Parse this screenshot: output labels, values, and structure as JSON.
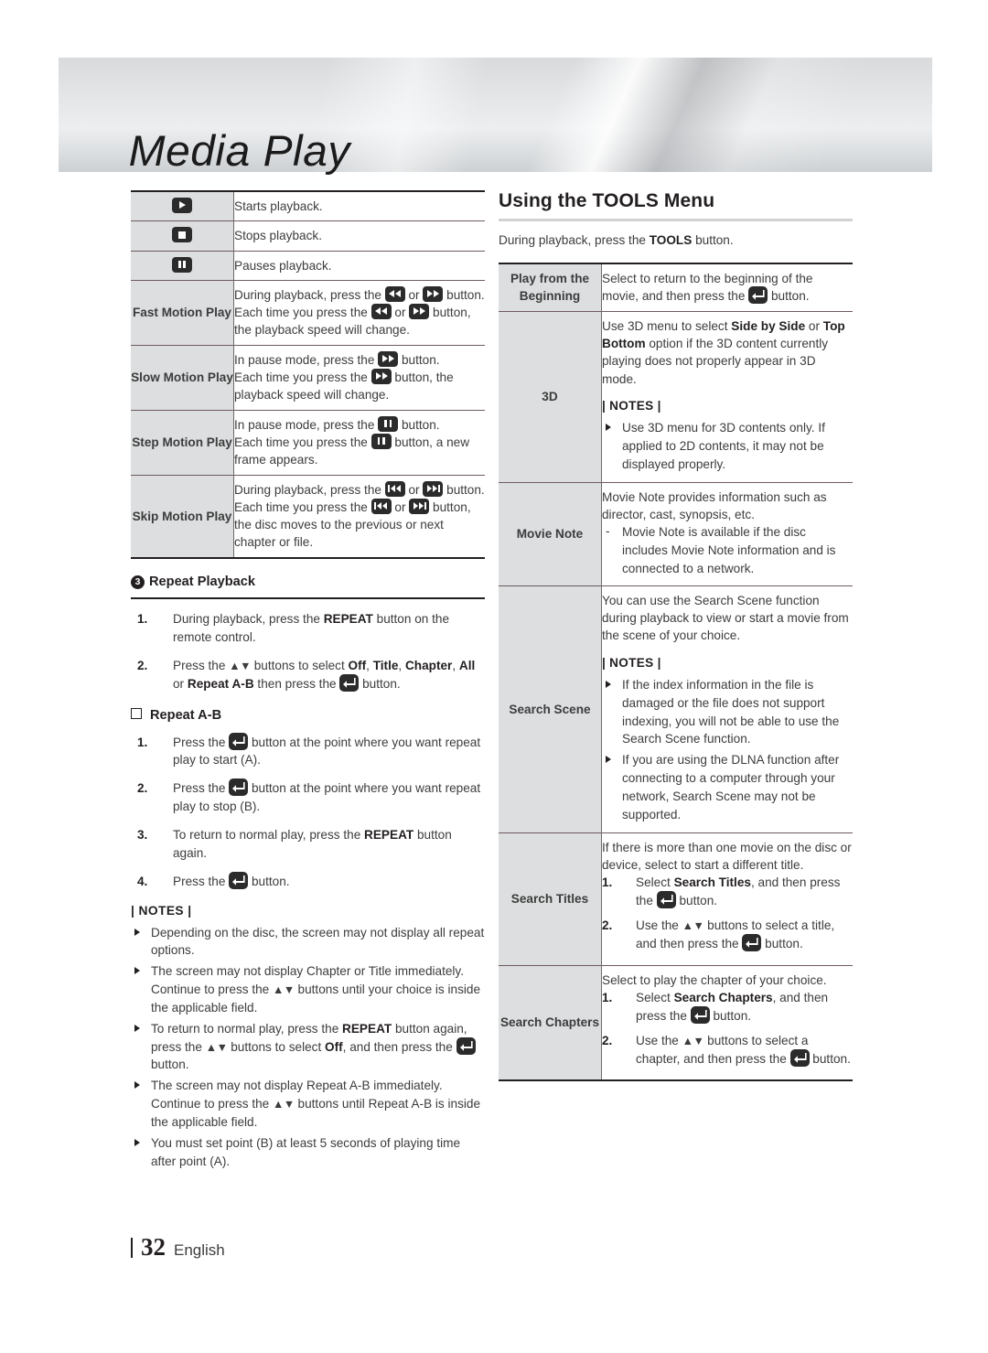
{
  "page": {
    "chapter_title": "Media Play",
    "footer": {
      "page_number": "32",
      "language": "English"
    }
  },
  "playback_table": {
    "rows": [
      {
        "key_icon": "play-icon",
        "key_text": "",
        "desc": "Starts playback."
      },
      {
        "key_icon": "stop-icon",
        "key_text": "",
        "desc": "Stops playback."
      },
      {
        "key_icon": "pause-icon",
        "key_text": "",
        "desc": "Pauses playback."
      },
      {
        "key_icon": "",
        "key_text": "Fast Motion Play",
        "line1a": "During playback, press the ",
        "line1b": " or ",
        "line1c": " button.",
        "line2a": "Each time you press the ",
        "line2b": " or ",
        "line2c": " button, the playback speed will change."
      },
      {
        "key_icon": "",
        "key_text": "Slow Motion Play",
        "line1a": "In pause mode, press the ",
        "line1c": " button.",
        "line2a": "Each time you press the ",
        "line2c": " button, the playback speed will change."
      },
      {
        "key_icon": "",
        "key_text": "Step Motion Play",
        "line1a": "In pause mode, press the ",
        "line1c": " button.",
        "line2a": "Each time you press the ",
        "line2c": " button, a new frame appears."
      },
      {
        "key_icon": "",
        "key_text": "Skip Motion Play",
        "line1a": "During playback, press the ",
        "line1b": " or ",
        "line1c": " button.",
        "line2a": "Each time you press the ",
        "line2b": " or ",
        "line2c": " button, the disc moves to the previous or next chapter or file."
      }
    ]
  },
  "repeat_playback": {
    "marker": "3",
    "heading": "Repeat Playback",
    "steps": [
      {
        "num": "1.",
        "text": "During playback, press the REPEAT button on the remote control."
      },
      {
        "num": "2.",
        "text_parts": [
          "Press the ",
          " buttons to select ",
          "Off",
          ", ",
          "Title",
          ", ",
          "Chapter",
          ", ",
          "All",
          " or ",
          "Repeat A-B",
          " then press the ",
          " button."
        ]
      }
    ],
    "step1_pre": "During playback, press the ",
    "step1_bold": "REPEAT",
    "step1_post": " button on the remote control."
  },
  "repeat_ab": {
    "heading": "Repeat A-B",
    "steps": [
      {
        "num": "1.",
        "pre": "Press the ",
        "post": " button at the point where you want repeat play to start (A)."
      },
      {
        "num": "2.",
        "pre": "Press the ",
        "post": " button at the point where you want repeat play to stop (B)."
      },
      {
        "num": "3.",
        "pre": "To return to normal play, press the ",
        "bold": "REPEAT",
        "post": " button again."
      },
      {
        "num": "4.",
        "pre": "Press the ",
        "post": " button."
      }
    ]
  },
  "left_notes": {
    "label": "| NOTES |",
    "items": [
      {
        "text": "Depending on the disc, the screen may not display all repeat options."
      },
      {
        "a": "The screen may not display Chapter or Title immediately. Continue to press the ",
        "b": " buttons until your choice is inside the applicable field."
      },
      {
        "a": "To return to normal play, press the ",
        "bold1": "REPEAT",
        "b": " button again, press the ",
        "c": " buttons to select ",
        "bold2": "Off",
        "d": ", and then press the ",
        "e": " button."
      },
      {
        "a": "The screen may not display Repeat A-B immediately. Continue to press the ",
        "b": " buttons until Repeat A-B is inside the applicable field."
      },
      {
        "text": "You must set point (B) at least 5 seconds of playing time after point (A)."
      }
    ]
  },
  "tools": {
    "heading": "Using the TOOLS Menu",
    "lead_pre": "During playback, press the ",
    "lead_bold": "TOOLS",
    "lead_post": " button.",
    "rows": {
      "play_from_beginning": {
        "key": "Play from the Beginning",
        "pre": "Select to return to the beginning of the movie, and then press the ",
        "post": " button."
      },
      "three_d": {
        "key": "3D",
        "p1_a": "Use 3D menu to select ",
        "p1_b1": "Side by Side",
        "p1_c": " or ",
        "p1_b2": "Top Bottom",
        "p1_d": " option if the 3D content currently playing does not properly appear in 3D mode.",
        "notes_label": "| NOTES |",
        "note1": "Use 3D menu for 3D contents only. If applied to 2D contents, it may not be displayed properly."
      },
      "movie_note": {
        "key": "Movie Note",
        "p1": "Movie Note provides information such as director, cast, synopsis, etc.",
        "dash1": "Movie Note is available if the disc includes Movie Note information and is connected to a network."
      },
      "search_scene": {
        "key": "Search Scene",
        "p1": "You can use the Search Scene function during playback to view or start a movie from the scene of your choice.",
        "notes_label": "| NOTES |",
        "note1": "If the index information in the file is damaged or the file does not support indexing, you will not be able to use the Search Scene function.",
        "note2": "If you are using the DLNA function after connecting to a computer through your network, Search Scene may not be supported."
      },
      "search_titles": {
        "key": "Search Titles",
        "p1": "If there is more than one movie on the disc or device, select to start a different title.",
        "step1_num": "1.",
        "step1_a": "Select ",
        "step1_bold": "Search Titles",
        "step1_b": ", and then press the ",
        "step1_c": " button.",
        "step2_num": "2.",
        "step2_a": "Use the ",
        "step2_b": " buttons to select a title, and then press the ",
        "step2_c": " button."
      },
      "search_chapters": {
        "key": "Search Chapters",
        "p1": "Select to play the chapter of your choice.",
        "step1_num": "1.",
        "step1_a": "Select ",
        "step1_bold": "Search Chapters",
        "step1_b": ", and then press the ",
        "step1_c": " button.",
        "step2_num": "2.",
        "step2_a": "Use the ",
        "step2_b": " buttons to select a chapter, and then press the ",
        "step2_c": " button."
      }
    }
  },
  "glyphs": {
    "play": "play-icon",
    "stop": "stop-icon",
    "pause": "pause-icon",
    "rewind": "rewind-icon",
    "forward": "fast-forward-icon",
    "prev": "skip-previous-icon",
    "next": "skip-next-icon",
    "enter": "enter-icon",
    "updown": "▲▼"
  },
  "colors": {
    "text": "#3c3c3c",
    "heading": "#231f20",
    "table_key_bg": "#dcdedf",
    "rule": "#231f20",
    "banner_light": "#eceef0",
    "banner_dark": "#cdd0d3"
  }
}
